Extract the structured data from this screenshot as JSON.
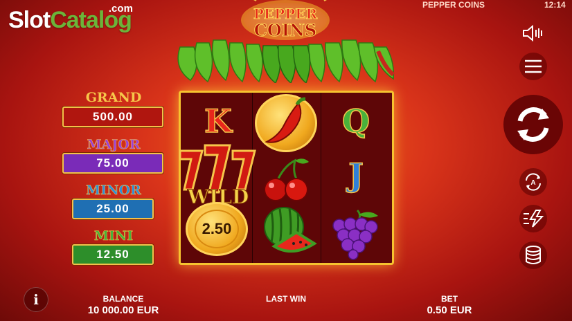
{
  "watermark": {
    "slot": "Slot",
    "catalog": "Catalog",
    "com": ".com"
  },
  "status": {
    "game_name": "PEPPER COINS",
    "time": "12:14"
  },
  "logo": {
    "line1": "PEPPER",
    "line2": "COINS"
  },
  "jackpots": [
    {
      "name": "GRAND",
      "value": "500.00",
      "title_color": "#f6c64a",
      "box_color": "#b0160f"
    },
    {
      "name": "MAJOR",
      "value": "75.00",
      "title_color": "#9b3fd6",
      "box_color": "#7a2bb8"
    },
    {
      "name": "MINOR",
      "value": "25.00",
      "title_color": "#2f8fd8",
      "box_color": "#1f6fb3"
    },
    {
      "name": "MINI",
      "value": "12.50",
      "title_color": "#49b23b",
      "box_color": "#2d8e2a"
    }
  ],
  "reels": {
    "symbol_k": "K",
    "symbol_q": "Q",
    "symbol_j": "J",
    "wild_label": "WILD",
    "coin_value": "2.50"
  },
  "icons": [
    "sound-icon",
    "menu-icon",
    "spin-icon",
    "autoplay-icon",
    "turbo-icon",
    "coins-icon",
    "info-icon"
  ],
  "footer": {
    "balance_label": "BALANCE",
    "balance_value": "10 000.00 EUR",
    "last_win_label": "LAST WIN",
    "bet_label": "BET",
    "bet_value": "0.50 EUR"
  },
  "colors": {
    "frame_gold": "#f6c32f",
    "background_red": "#d9341a"
  }
}
